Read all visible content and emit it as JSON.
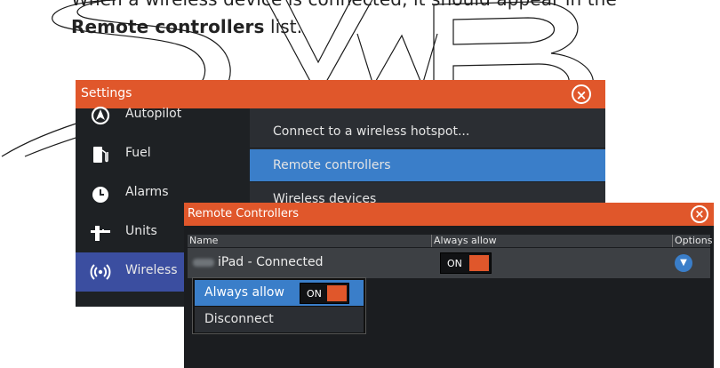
{
  "document": {
    "line1": "When a wireless device is connected, it should appear in the",
    "line2_bold": "Remote controllers",
    "line2_rest": " list."
  },
  "settings": {
    "title": "Settings",
    "close_icon": "close-circle-icon",
    "sidebar": [
      {
        "label": "Autopilot",
        "icon": "autopilot-icon"
      },
      {
        "label": "Fuel",
        "icon": "fuel-pump-icon"
      },
      {
        "label": "Alarms",
        "icon": "alarm-icon"
      },
      {
        "label": "Units",
        "icon": "units-icon"
      },
      {
        "label": "Wireless",
        "icon": "wireless-icon",
        "active": true
      }
    ],
    "menu": [
      {
        "label": "Connect to a wireless hotspot..."
      },
      {
        "label": "Remote controllers",
        "selected": true
      },
      {
        "label": "Wireless devices"
      }
    ]
  },
  "remote_controllers": {
    "title": "Remote Controllers",
    "columns": {
      "name": "Name",
      "always_allow": "Always allow",
      "options": "Options"
    },
    "rows": [
      {
        "device": "iPad - Connected",
        "always_allow": "ON"
      }
    ],
    "popup": {
      "always_allow_label": "Always allow",
      "toggle_state": "ON",
      "disconnect_label": "Disconnect"
    }
  },
  "colors": {
    "titlebar": "#e0572b",
    "selection": "#3a7ec9",
    "active_sidebar": "#3b4ea0",
    "background": "#25282c"
  }
}
